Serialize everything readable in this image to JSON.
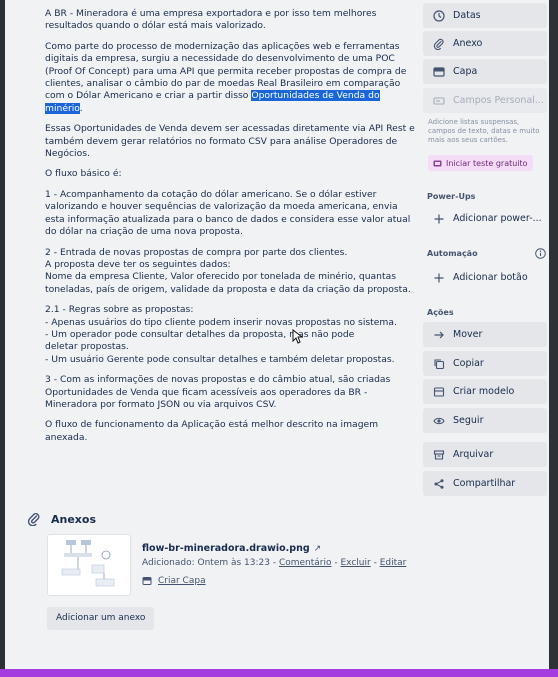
{
  "description": {
    "paragraphs": [
      "A BR - Mineradora é uma empresa exportadora e por isso tem melhores resultados quando o dólar está mais valorizado.",
      "Como parte do processo de modernização das aplicações web e ferramentas digitais da empresa, surgiu a necessidade do desenvolvimento de uma POC (Proof Of Concept) para uma API que permita receber propostas de compra de clientes, analisar o câmbio do par de moedas Real Brasileiro em comparação com o Dólar Americano e criar a partir disso ",
      "Essas Oportunidades de Venda devem ser acessadas diretamente via API Rest e também devem gerar relatórios no formato CSV para análise Operadores de Negócios.",
      "O fluxo básico é:",
      "1 - Acompanhamento da cotação do dólar americano. Se o dólar estiver valorizando e houver sequências de valorização da moeda americana, envia esta informação atualizada para o banco de dados e considera esse valor atual do dólar na criação de uma nova proposta.",
      "2 - Entrada de novas propostas de compra por parte dos clientes.",
      "A proposta deve ter os seguintes dados:",
      "Nome da empresa Cliente, Valor oferecido por tonelada de minério, quantas toneladas, país de origem, validade da proposta e data da criação da proposta.",
      "2.1 - Regras sobre as propostas:",
      "- Apenas usuários do tipo cliente podem inserir novas propostas no sistema.",
      "- Um operador pode consultar detalhes da proposta, mas não pode",
      "deletar propostas.",
      "- Um usuário Gerente pode consultar detalhes e também deletar propostas.",
      "3 - Com as informações de novas propostas e do câmbio atual, são criadas Oportunidades de Venda que ficam acessíveis aos operadores da BR - Mineradora por formato JSON ou via arquivos CSV.",
      "O fluxo de funcionamento da Aplicação está melhor descrito na imagem anexada."
    ],
    "highlight": "Oportunidades de Venda do minério",
    "after_highlight": "."
  },
  "attachments": {
    "header": "Anexos",
    "file_name": "flow-br-mineradora.drawio.png",
    "ext_icon": "↗",
    "meta_added": "Adicionado: Ontem às 13:23 - ",
    "meta_comment": "Comentário",
    "meta_sep1": " - ",
    "meta_delete": "Excluir",
    "meta_sep2": " - ",
    "meta_edit": "Editar",
    "make_cover": "Criar Capa",
    "add_button": "Adicionar um anexo"
  },
  "sidebar": {
    "add_to_card": [
      {
        "label": "Datas",
        "icon": "clock-icon"
      },
      {
        "label": "Anexo",
        "icon": "paperclip-icon"
      },
      {
        "label": "Capa",
        "icon": "card-cover-icon"
      },
      {
        "label": "Campos Personal...",
        "icon": "custom-fields-icon"
      }
    ],
    "note": "Adicione listas suspensas, campos de texto, datas e muito mais aos seus cartões.",
    "trial_button": "Iniciar teste gratuito",
    "powerups_title": "Power-Ups",
    "powerups_add": "Adicionar power-...",
    "automation_title": "Automação",
    "automation_add": "Adicionar botão",
    "actions_title": "Ações",
    "actions": [
      {
        "label": "Mover",
        "icon": "arrow-right-icon"
      },
      {
        "label": "Copiar",
        "icon": "copy-icon"
      },
      {
        "label": "Criar modelo",
        "icon": "template-icon"
      },
      {
        "label": "Seguir",
        "icon": "eye-icon"
      },
      {
        "label": "Arquivar",
        "icon": "archive-icon"
      },
      {
        "label": "Compartilhar",
        "icon": "share-icon"
      }
    ]
  },
  "colors": {
    "highlight_bg": "#1a66d9",
    "modal_bg": "#f1f2f4",
    "button_bg": "#e4e6ea",
    "trial_bg": "#f4dcf6",
    "bottom_bar": "#a43ce0"
  }
}
